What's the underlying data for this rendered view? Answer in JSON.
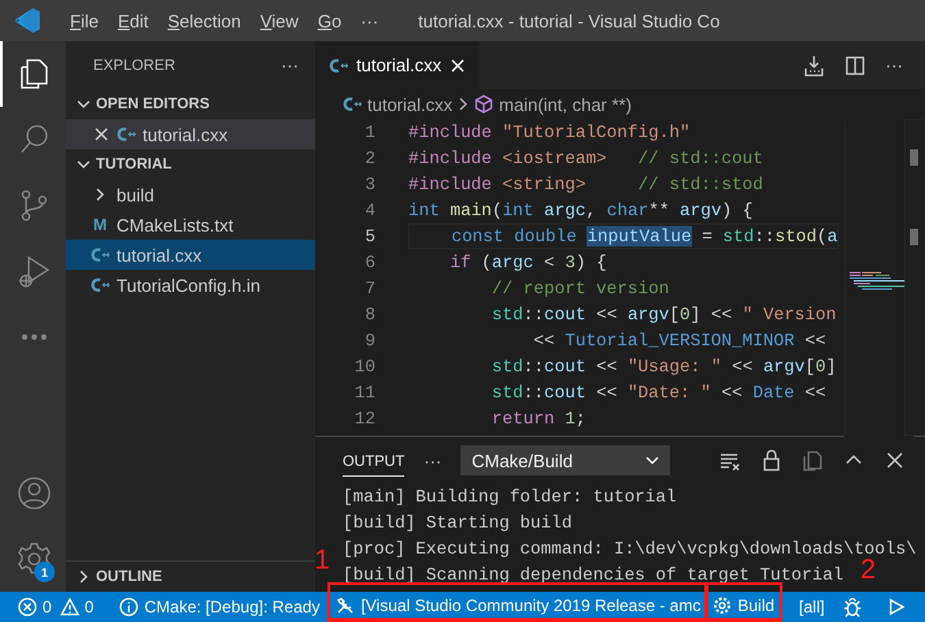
{
  "title_bar": {
    "menus": [
      "File",
      "Edit",
      "Selection",
      "View",
      "Go"
    ],
    "more": "···",
    "title": "tutorial.cxx - tutorial - Visual Studio Co"
  },
  "activity_bar": {
    "items": [
      {
        "kind": "explorer",
        "selected": true
      },
      {
        "kind": "search",
        "selected": false
      },
      {
        "kind": "source-control",
        "selected": false
      },
      {
        "kind": "run-debug",
        "selected": false
      },
      {
        "kind": "more",
        "selected": false
      }
    ],
    "bottom": [
      {
        "kind": "account"
      },
      {
        "kind": "settings",
        "badge": "1"
      }
    ]
  },
  "sidebar": {
    "title": "EXPLORER",
    "more": "···",
    "sections": [
      {
        "title": "OPEN EDITORS",
        "expanded": true,
        "items": [
          {
            "name": "tutorial.cxx",
            "kind": "cpp",
            "active": true,
            "selected": false
          }
        ]
      },
      {
        "title": "TUTORIAL",
        "expanded": true,
        "items": [
          {
            "name": "build",
            "kind": "folder",
            "expanded": false,
            "selected": false
          },
          {
            "name": "CMakeLists.txt",
            "kind": "cmake",
            "glyph": "M",
            "selected": false
          },
          {
            "name": "tutorial.cxx",
            "kind": "cpp",
            "selected": true
          },
          {
            "name": "TutorialConfig.h.in",
            "kind": "cpp",
            "selected": false
          }
        ]
      }
    ],
    "outline": {
      "title": "OUTLINE",
      "expanded": false
    }
  },
  "editor": {
    "tabs": [
      {
        "label": "tutorial.cxx",
        "selected": true
      }
    ],
    "more": "···",
    "breadcrumb": [
      "tutorial.cxx",
      "main(int, char **)"
    ],
    "lines": [
      {
        "number": "1",
        "current": false,
        "tokens": [
          {
            "kind": "pre",
            "t": "#include "
          },
          {
            "kind": "str",
            "t": "\"TutorialConfig.h\""
          }
        ]
      },
      {
        "number": "2",
        "current": false,
        "tokens": [
          {
            "kind": "pre",
            "t": "#include "
          },
          {
            "kind": "str",
            "t": "<iostream>   "
          },
          {
            "kind": "com",
            "t": "// std::cout"
          }
        ]
      },
      {
        "number": "3",
        "current": false,
        "tokens": [
          {
            "kind": "pre",
            "t": "#include "
          },
          {
            "kind": "str",
            "t": "<string>     "
          },
          {
            "kind": "com",
            "t": "// std::stod"
          }
        ]
      },
      {
        "number": "4",
        "current": false,
        "tokens": [
          {
            "kind": "kw",
            "t": "int "
          },
          {
            "kind": "fn",
            "t": "main"
          },
          {
            "kind": "plain",
            "t": "("
          },
          {
            "kind": "kw",
            "t": "int "
          },
          {
            "kind": "var",
            "t": "argc"
          },
          {
            "kind": "plain",
            "t": ", "
          },
          {
            "kind": "kw",
            "t": "char"
          },
          {
            "kind": "plain",
            "t": "** "
          },
          {
            "kind": "var",
            "t": "argv"
          },
          {
            "kind": "plain",
            "t": ") {"
          }
        ]
      },
      {
        "number": "5",
        "current": true,
        "tokens": [
          {
            "kind": "kw",
            "t": "    const double "
          },
          {
            "kind": "var",
            "t": "inputValue",
            "highlighted": true
          },
          {
            "kind": "plain",
            "t": " = "
          },
          {
            "kind": "type",
            "t": "std"
          },
          {
            "kind": "plain",
            "t": "::"
          },
          {
            "kind": "fn",
            "t": "stod"
          },
          {
            "kind": "plain",
            "t": "("
          },
          {
            "kind": "var",
            "t": "a"
          }
        ]
      },
      {
        "number": "6",
        "current": false,
        "tokens": [
          {
            "kind": "ctl",
            "t": "    if"
          },
          {
            "kind": "plain",
            "t": " ("
          },
          {
            "kind": "var",
            "t": "argc"
          },
          {
            "kind": "plain",
            "t": " < "
          },
          {
            "kind": "num",
            "t": "3"
          },
          {
            "kind": "plain",
            "t": ") {"
          }
        ]
      },
      {
        "number": "7",
        "current": false,
        "tokens": [
          {
            "kind": "com",
            "t": "        // report version"
          }
        ]
      },
      {
        "number": "8",
        "current": false,
        "tokens": [
          {
            "kind": "type",
            "t": "        std"
          },
          {
            "kind": "plain",
            "t": "::"
          },
          {
            "kind": "var",
            "t": "cout"
          },
          {
            "kind": "plain",
            "t": " << "
          },
          {
            "kind": "var",
            "t": "argv"
          },
          {
            "kind": "plain",
            "t": "["
          },
          {
            "kind": "num",
            "t": "0"
          },
          {
            "kind": "plain",
            "t": "] << "
          },
          {
            "kind": "str",
            "t": "\" Version"
          }
        ]
      },
      {
        "number": "9",
        "current": false,
        "tokens": [
          {
            "kind": "plain",
            "t": "            << "
          },
          {
            "kind": "macro",
            "t": "Tutorial_VERSION_MINOR"
          },
          {
            "kind": "plain",
            "t": " <<"
          }
        ]
      },
      {
        "number": "10",
        "current": false,
        "tokens": [
          {
            "kind": "type",
            "t": "        std"
          },
          {
            "kind": "plain",
            "t": "::"
          },
          {
            "kind": "var",
            "t": "cout"
          },
          {
            "kind": "plain",
            "t": " << "
          },
          {
            "kind": "str",
            "t": "\"Usage: \""
          },
          {
            "kind": "plain",
            "t": " << "
          },
          {
            "kind": "var",
            "t": "argv"
          },
          {
            "kind": "plain",
            "t": "["
          },
          {
            "kind": "num",
            "t": "0"
          },
          {
            "kind": "plain",
            "t": "]"
          }
        ]
      },
      {
        "number": "11",
        "current": false,
        "tokens": [
          {
            "kind": "type",
            "t": "        std"
          },
          {
            "kind": "plain",
            "t": "::"
          },
          {
            "kind": "var",
            "t": "cout"
          },
          {
            "kind": "plain",
            "t": " << "
          },
          {
            "kind": "str",
            "t": "\"Date: \""
          },
          {
            "kind": "plain",
            "t": " << "
          },
          {
            "kind": "macro",
            "t": "Date"
          },
          {
            "kind": "plain",
            "t": " <<"
          }
        ]
      },
      {
        "number": "12",
        "current": false,
        "tokens": [
          {
            "kind": "ctl",
            "t": "        return "
          },
          {
            "kind": "num",
            "t": "1"
          },
          {
            "kind": "plain",
            "t": ";"
          }
        ]
      }
    ]
  },
  "panel": {
    "tabs": [
      {
        "label": "OUTPUT",
        "selected": true
      }
    ],
    "more": "···",
    "channel": "CMake/Build",
    "lines": [
      "[main] Building folder: tutorial",
      "[build] Starting build",
      "[proc] Executing command: I:\\dev\\vcpkg\\downloads\\tools\\",
      "[build] Scanning dependencies of target Tutorial"
    ]
  },
  "status_bar": {
    "items": [
      {
        "kind": "problems",
        "errors": "0",
        "warnings": "0"
      },
      {
        "kind": "info",
        "text": "CMake: [Debug]: Ready"
      },
      {
        "kind": "kit",
        "text": "[Visual Studio Community 2019 Release - amc",
        "annotation": "1"
      },
      {
        "kind": "build",
        "text": "Build",
        "annotation": "2"
      },
      {
        "kind": "target",
        "text": "[all]"
      },
      {
        "kind": "debug"
      },
      {
        "kind": "run"
      }
    ]
  }
}
